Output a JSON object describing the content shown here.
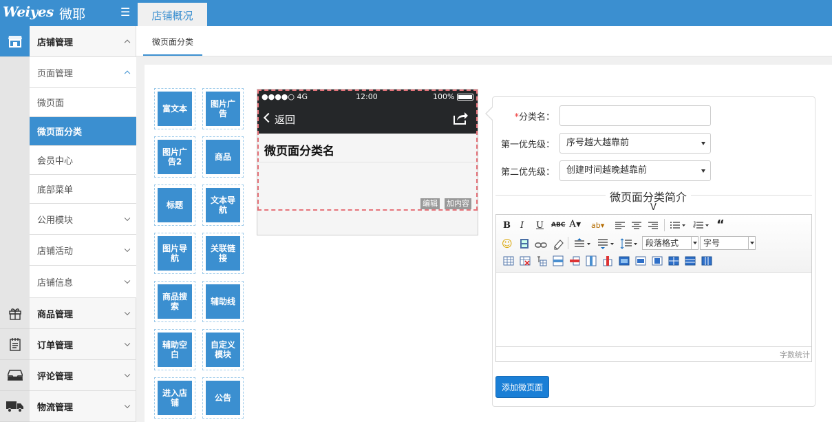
{
  "app": {
    "logo_text": "Weiyes",
    "logo_cn": "微耶",
    "menu_icon": "hamburger-icon"
  },
  "topbar": {
    "tab": "店铺概况"
  },
  "subnav": {
    "tab": "微页面分类"
  },
  "sidebar": {
    "icons": [
      "store-icon",
      "gift-icon",
      "clipboard-icon",
      "inbox-icon",
      "truck-icon"
    ],
    "items": [
      {
        "label": "店铺管理"
      },
      {
        "label": "页面管理"
      },
      {
        "label": "微页面"
      },
      {
        "label": "微页面分类"
      },
      {
        "label": "会员中心"
      },
      {
        "label": "底部菜单"
      },
      {
        "label": "公用模块"
      },
      {
        "label": "店铺活动"
      },
      {
        "label": "店铺信息"
      },
      {
        "label": "商品管理"
      },
      {
        "label": "订单管理"
      },
      {
        "label": "评论管理"
      },
      {
        "label": "物流管理"
      }
    ]
  },
  "components": [
    {
      "label": "富文本"
    },
    {
      "label": "图片广告"
    },
    {
      "label": "图片广告2"
    },
    {
      "label": "商品"
    },
    {
      "label": "标题"
    },
    {
      "label": "文本导航"
    },
    {
      "label": "图片导航"
    },
    {
      "label": "关联链接"
    },
    {
      "label": "商品搜索"
    },
    {
      "label": "辅助线"
    },
    {
      "label": "辅助空白"
    },
    {
      "label": "自定义模块"
    },
    {
      "label": "进入店铺"
    },
    {
      "label": "公告"
    }
  ],
  "phone": {
    "signal": "●●●●○ 4G",
    "time": "12:00",
    "battery": "100%",
    "back": "返回",
    "title": "微页面分类名",
    "edit": "编辑",
    "add_content": "加内容"
  },
  "form": {
    "name_label": "分类名：",
    "name_value": "",
    "required_mark": "*",
    "priority1_label": "第一优先级：",
    "priority1_value": "序号越大越靠前",
    "priority2_label": "第二优先级：",
    "priority2_value": "创建时间越晚越靠前",
    "intro_legend": "微页面分类简介",
    "stray_char": "V",
    "para_format": "段落格式",
    "font_size": "字号",
    "word_count": "字数统计",
    "submit": "添加微页面"
  },
  "colors": {
    "brand": "#3b8fd0",
    "button": "#1a7fd6",
    "phone_bar": "#252729",
    "dashed": "#e6737a"
  }
}
